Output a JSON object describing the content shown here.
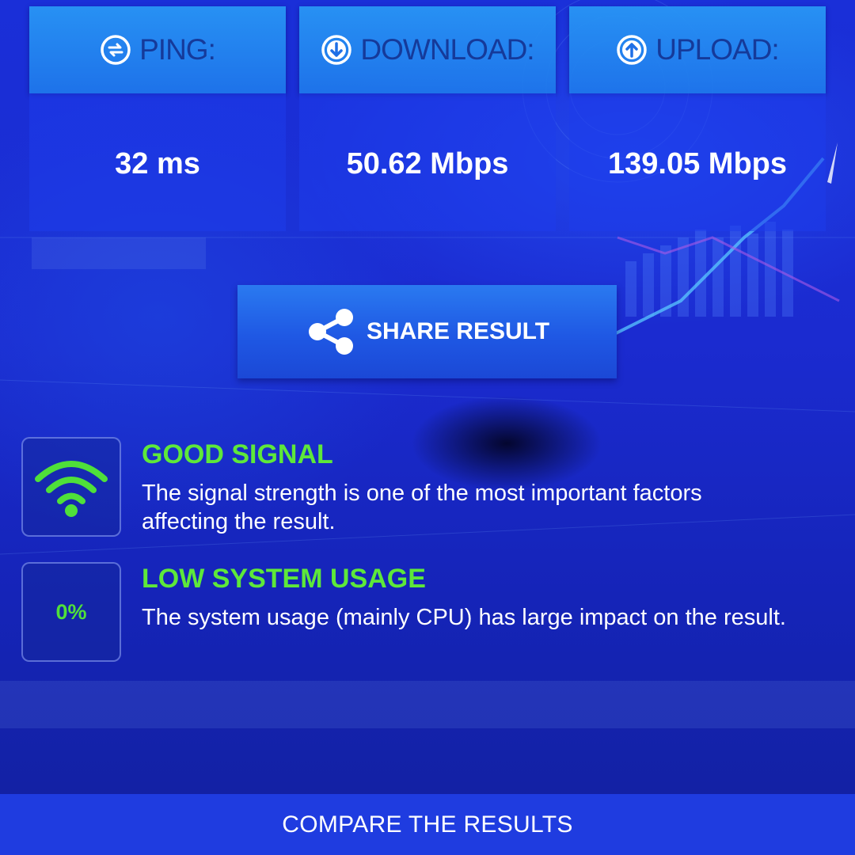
{
  "stats": [
    {
      "label": "PING:",
      "value": "32 ms",
      "icon": "swap-arrows-icon"
    },
    {
      "label": "DOWNLOAD:",
      "value": "50.62 Mbps",
      "icon": "download-arrow-icon"
    },
    {
      "label": "UPLOAD:",
      "value": "139.05 Mbps",
      "icon": "upload-arrow-icon"
    }
  ],
  "share": {
    "label": "SHARE RESULT",
    "icon": "share-icon"
  },
  "signal": {
    "title": "GOOD SIGNAL",
    "description": "The signal strength is one of the most important factors affecting the result.",
    "icon": "wifi-icon"
  },
  "usage": {
    "value": "0%",
    "title": "LOW SYSTEM USAGE",
    "description": "The system usage (mainly CPU) has large impact on the result."
  },
  "footer": {
    "compare_label": "COMPARE THE RESULTS"
  },
  "colors": {
    "accent_green": "#5ee83a",
    "header_blue": "#2a8ef2",
    "background_blue": "#1b2bd0",
    "footer_blue": "#1f3ce0"
  }
}
